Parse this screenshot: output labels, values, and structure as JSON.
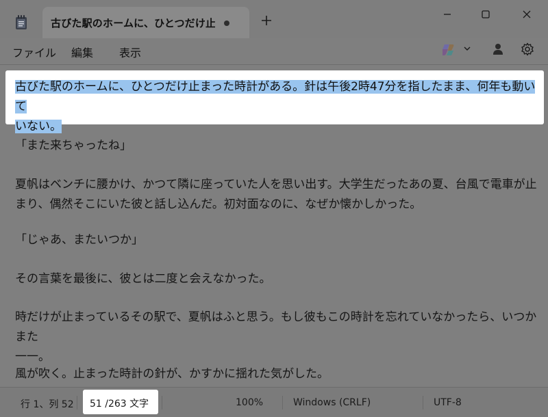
{
  "window": {
    "tab_title": "古びた駅のホームに、ひとつだけ止まった時",
    "new_tab_symbol": "+",
    "icons": [
      "notepad-icon",
      "plus-icon",
      "minimize-icon",
      "maximize-icon",
      "close-icon"
    ]
  },
  "menu": {
    "file": "ファイル",
    "edit": "編集",
    "view": "表示",
    "icons": [
      "copilot-icon",
      "chevron-down-icon",
      "profile-icon",
      "gear-icon"
    ]
  },
  "document": {
    "selected_line1": "古びた駅のホームに、ひとつだけ止まった時計がある。針は午後2時47分を指したまま、何年も動いて",
    "selected_line2": "いない。",
    "p2": "「また来ちゃったね」",
    "p3_line1": "夏帆はベンチに腰かけ、かつて隣に座っていた人を思い出す。大学生だったあの夏、台風で電車が止",
    "p3_line2": "まり、偶然そこにいた彼と話し込んだ。初対面なのに、なぜか懐かしかった。",
    "p4": "「じゃあ、またいつか」",
    "p5": "その言葉を最後に、彼とは二度と会えなかった。",
    "p6_line1": "時だけが止まっているその駅で、夏帆はふと思う。もし彼もこの時計を忘れていなかったら、いつかまた",
    "p6_line2": "一一。",
    "p7": "風が吹く。止まった時計の針が、かすかに揺れた気がした。"
  },
  "status": {
    "position": "行 1、列 52",
    "char_count": "51 /263 文字",
    "zoom": "100%",
    "line_ending": "Windows (CRLF)",
    "encoding": "UTF-8"
  }
}
